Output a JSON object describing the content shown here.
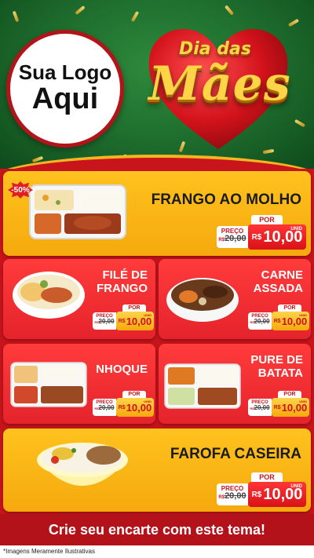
{
  "header": {
    "logo_line1": "Sua Logo",
    "logo_line2": "Aqui",
    "title_small": "Dia das",
    "title_big": "Mães"
  },
  "colors": {
    "red": "#c8141b",
    "yellow": "#f5a90d",
    "green": "#1d6b2c",
    "gold": "#ffd447"
  },
  "products": [
    {
      "name": "FRANGO AO MOLHO",
      "discount_badge": "-50%",
      "label_preco": "PREÇO",
      "old_price": "20,00",
      "old_prefix": "R$",
      "label_por": "POR",
      "currency": "R$",
      "price": "10,00",
      "unit": "UNID"
    },
    {
      "name_line1": "FILÉ DE",
      "name_line2": "FRANGO",
      "label_preco": "PREÇO",
      "old_price": "20,00",
      "old_prefix": "R$",
      "label_por": "POR",
      "currency": "R$",
      "price": "10,00",
      "unit": "UNID"
    },
    {
      "name_line1": "CARNE",
      "name_line2": "ASSADA",
      "label_preco": "PREÇO",
      "old_price": "20,00",
      "old_prefix": "R$",
      "label_por": "POR",
      "currency": "R$",
      "price": "10,00",
      "unit": "UNID"
    },
    {
      "name": "NHOQUE",
      "label_preco": "PREÇO",
      "old_price": "20,00",
      "old_prefix": "R$",
      "label_por": "POR",
      "currency": "R$",
      "price": "10,00",
      "unit": "UNID"
    },
    {
      "name_line1": "PURE DE",
      "name_line2": "BATATA",
      "label_preco": "PREÇO",
      "old_price": "20,00",
      "old_prefix": "R$",
      "label_por": "POR",
      "currency": "R$",
      "price": "10,00",
      "unit": "UNID"
    },
    {
      "name": "FAROFA CASEIRA",
      "label_preco": "PREÇO",
      "old_price": "20,00",
      "old_prefix": "R$",
      "label_por": "POR",
      "currency": "R$",
      "price": "10,00",
      "unit": "UNID"
    }
  ],
  "footer": {
    "cta": "Crie seu encarte com este tema!",
    "disclaimer": "*Imagens Meramente Ilustrativas"
  }
}
